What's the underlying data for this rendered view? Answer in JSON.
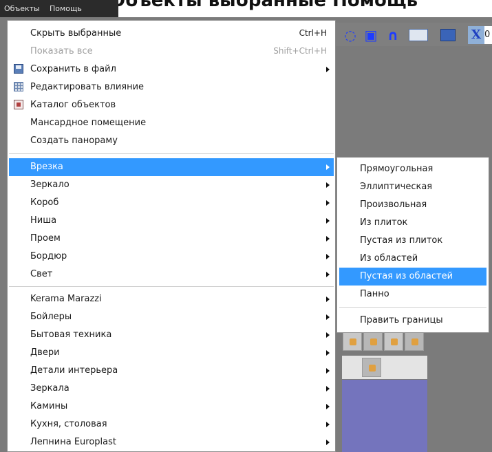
{
  "banner_text": "Объекты выбранные Помощь",
  "menubar": {
    "items": [
      "Объекты",
      "Помощь"
    ]
  },
  "toolbar": {
    "x_label": "X",
    "x_value": "0"
  },
  "menu": {
    "top_items": [
      {
        "label": "Скрыть выбранные",
        "shortcut": "Ctrl+H"
      },
      {
        "label": "Показать все",
        "shortcut": "Shift+Ctrl+H",
        "disabled": true
      },
      {
        "label": "Сохранить в файл",
        "icon": "save-icon",
        "submenu": true
      },
      {
        "label": "Редактировать влияние",
        "icon": "grid-icon"
      },
      {
        "label": "Каталог объектов",
        "icon": "catalog-icon"
      },
      {
        "label": "Мансардное помещение"
      },
      {
        "label": "Создать панораму"
      }
    ],
    "tool_items": [
      {
        "label": "Врезка",
        "highlighted": true
      },
      {
        "label": "Зеркало"
      },
      {
        "label": "Короб"
      },
      {
        "label": "Ниша"
      },
      {
        "label": "Проем"
      },
      {
        "label": "Бордюр"
      },
      {
        "label": "Свет"
      }
    ],
    "catalog_items": [
      {
        "label": "Kerama Marazzi"
      },
      {
        "label": "Бойлеры"
      },
      {
        "label": "Бытовая техника"
      },
      {
        "label": "Двери"
      },
      {
        "label": "Детали интерьера"
      },
      {
        "label": "Зеркала"
      },
      {
        "label": "Камины"
      },
      {
        "label": "Кухня, столовая"
      },
      {
        "label": "Лепнина Europlast"
      }
    ]
  },
  "submenu": {
    "items": [
      {
        "label": "Прямоугольная"
      },
      {
        "label": "Эллиптическая"
      },
      {
        "label": "Произвольная"
      },
      {
        "label": "Из плиток"
      },
      {
        "label": "Пустая из плиток"
      },
      {
        "label": "Из областей"
      },
      {
        "label": "Пустая из областей",
        "highlighted": true
      },
      {
        "label": "Панно"
      }
    ],
    "footer_item": "Править границы"
  },
  "colors": {
    "highlight": "#3399ff",
    "menubar": "#2b2b2b",
    "app_background": "#7b7b7b",
    "canvas_purple": "#7474bd"
  }
}
